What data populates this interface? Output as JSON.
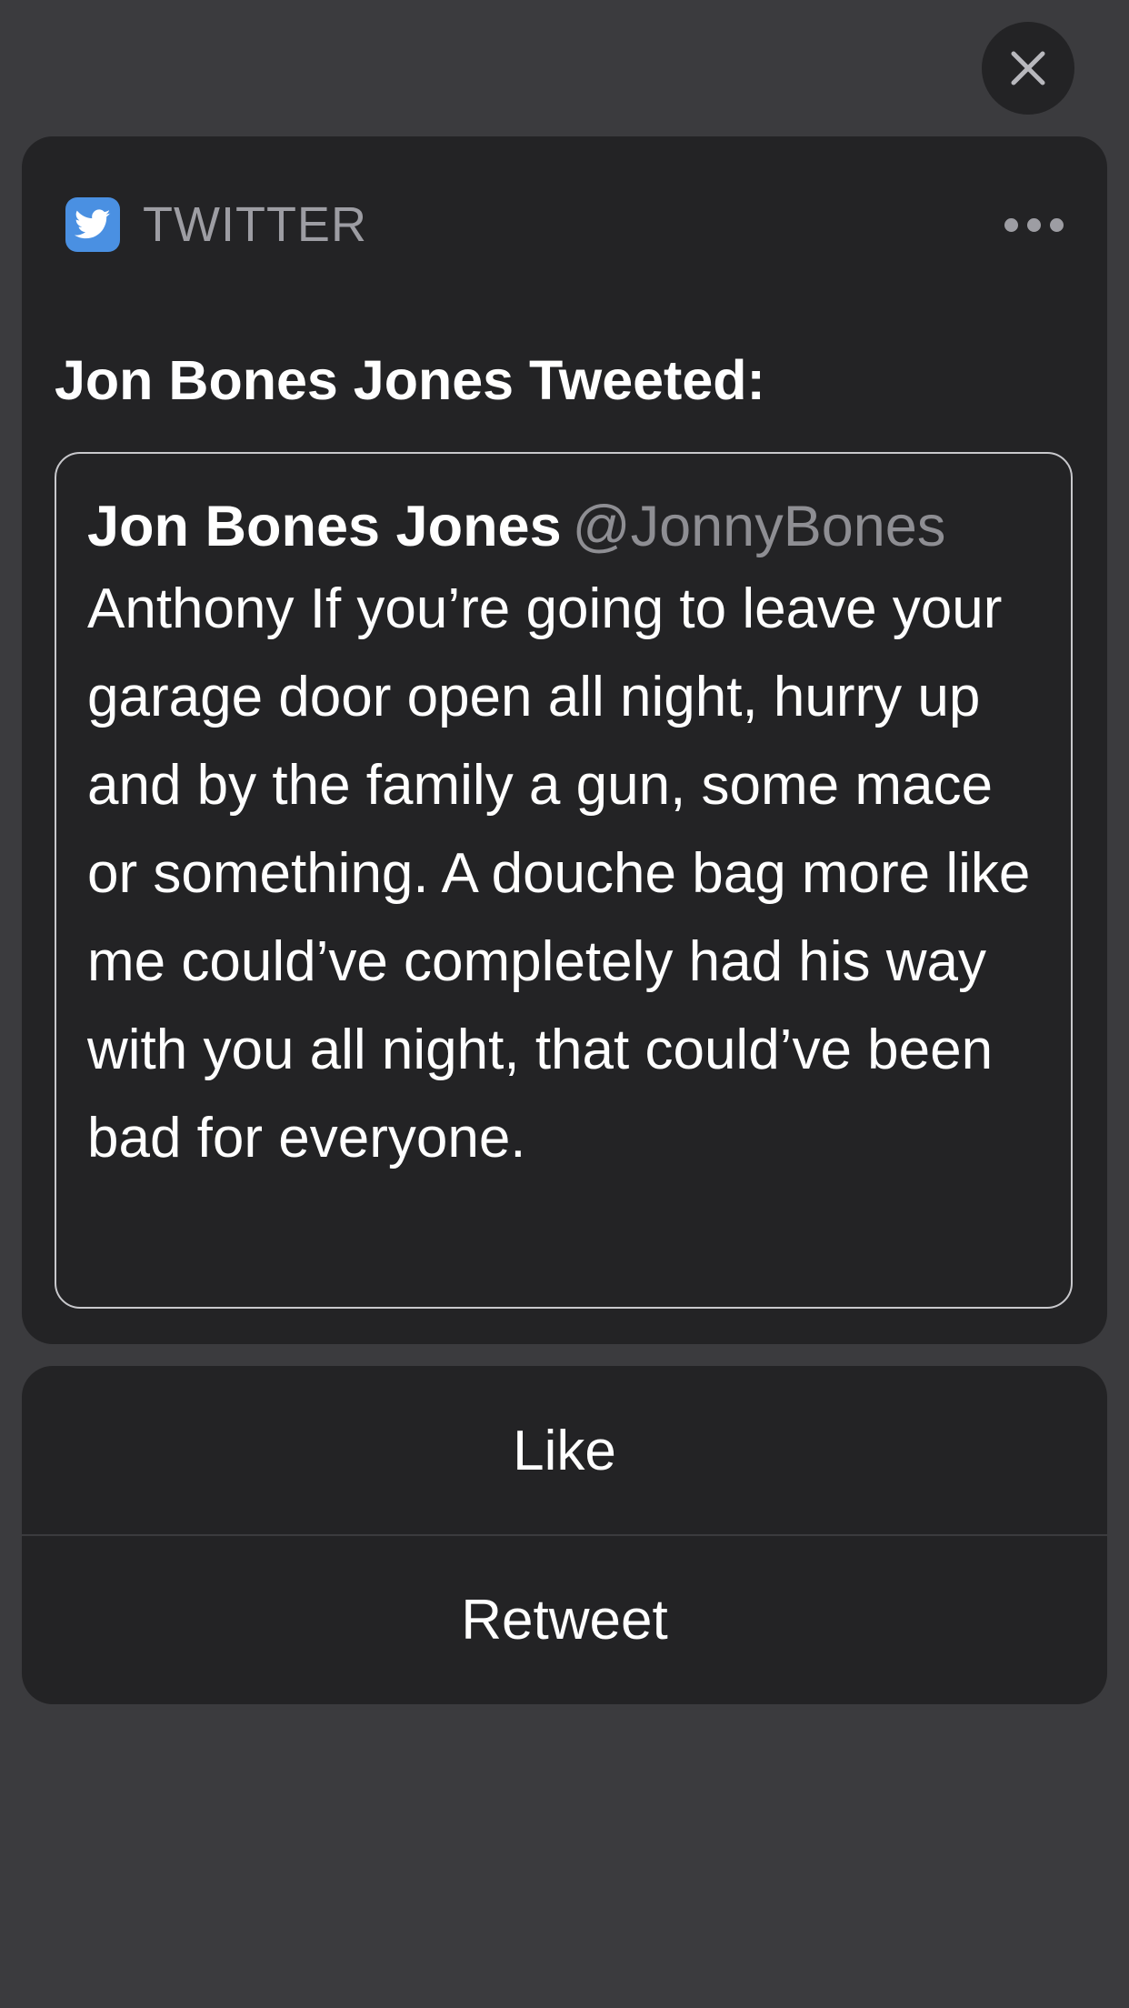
{
  "controls": {
    "close_icon": "close-icon",
    "more_icon": "more-horizontal-icon"
  },
  "notification": {
    "app_name": "TWITTER",
    "app_icon": "twitter-bird-icon",
    "app_icon_color": "#4a90e2",
    "title": "Jon Bones Jones Tweeted:",
    "tweet": {
      "author": "Jon Bones Jones",
      "handle": "@JonnyBones",
      "text": "Anthony If you’re going to leave your garage door open all night, hurry up and by the family a gun, some mace or something. A douche bag more like me could’ve completely had his way with you all night, that could’ve been bad for everyone."
    }
  },
  "actions": [
    {
      "label": "Like"
    },
    {
      "label": "Retweet"
    }
  ],
  "colors": {
    "background": "#3b3b3e",
    "card": "#232325",
    "secondary_text": "#9d9da3",
    "handle_text": "#8e8e93"
  }
}
